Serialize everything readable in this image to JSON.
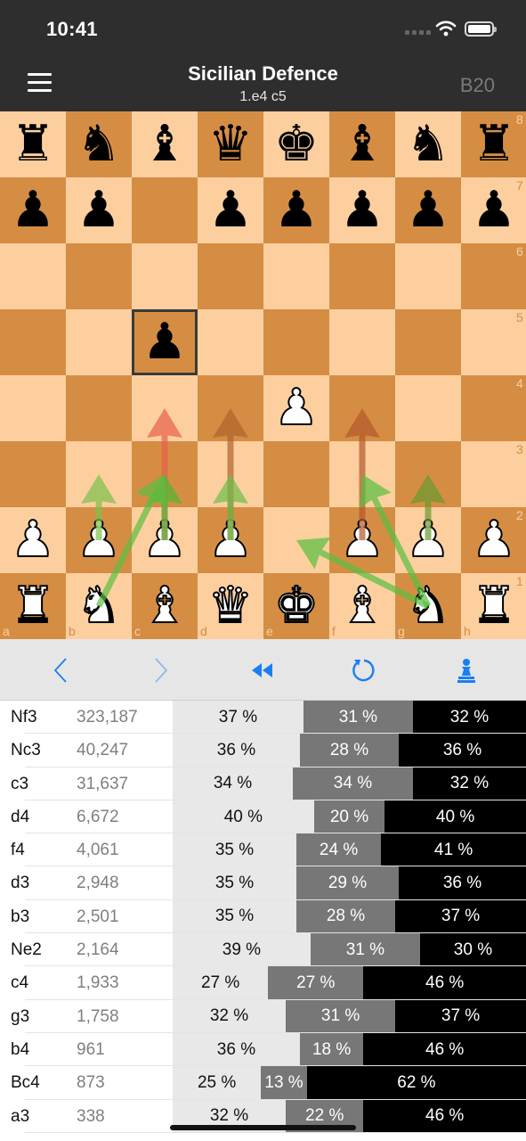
{
  "status": {
    "time": "10:41"
  },
  "nav": {
    "title": "Sicilian Defence",
    "subtitle": "1.e4 c5",
    "eco": "B20"
  },
  "board": {
    "files": [
      "a",
      "b",
      "c",
      "d",
      "e",
      "f",
      "g",
      "h"
    ],
    "ranks": [
      "8",
      "7",
      "6",
      "5",
      "4",
      "3",
      "2",
      "1"
    ],
    "last_move_square": "c5",
    "pieces": [
      {
        "sq": "a8",
        "p": "r"
      },
      {
        "sq": "b8",
        "p": "n"
      },
      {
        "sq": "c8",
        "p": "b"
      },
      {
        "sq": "d8",
        "p": "q"
      },
      {
        "sq": "e8",
        "p": "k"
      },
      {
        "sq": "f8",
        "p": "b"
      },
      {
        "sq": "g8",
        "p": "n"
      },
      {
        "sq": "h8",
        "p": "r"
      },
      {
        "sq": "a7",
        "p": "p"
      },
      {
        "sq": "b7",
        "p": "p"
      },
      {
        "sq": "d7",
        "p": "p"
      },
      {
        "sq": "e7",
        "p": "p"
      },
      {
        "sq": "f7",
        "p": "p"
      },
      {
        "sq": "g7",
        "p": "p"
      },
      {
        "sq": "h7",
        "p": "p"
      },
      {
        "sq": "c5",
        "p": "p"
      },
      {
        "sq": "e4",
        "p": "P"
      },
      {
        "sq": "a2",
        "p": "P"
      },
      {
        "sq": "b2",
        "p": "P"
      },
      {
        "sq": "c2",
        "p": "P"
      },
      {
        "sq": "d2",
        "p": "P"
      },
      {
        "sq": "f2",
        "p": "P"
      },
      {
        "sq": "g2",
        "p": "P"
      },
      {
        "sq": "h2",
        "p": "P"
      },
      {
        "sq": "a1",
        "p": "R"
      },
      {
        "sq": "b1",
        "p": "N"
      },
      {
        "sq": "c1",
        "p": "B"
      },
      {
        "sq": "d1",
        "p": "Q"
      },
      {
        "sq": "e1",
        "p": "K"
      },
      {
        "sq": "f1",
        "p": "B"
      },
      {
        "sq": "g1",
        "p": "N"
      },
      {
        "sq": "h1",
        "p": "R"
      }
    ],
    "arrows": [
      {
        "from": "c2",
        "to": "c4",
        "color": "#e8604a"
      },
      {
        "from": "d2",
        "to": "d4",
        "color": "#b0642c"
      },
      {
        "from": "f2",
        "to": "f4",
        "color": "#b4582c"
      },
      {
        "from": "b2",
        "to": "b3",
        "color": "#7cc24a"
      },
      {
        "from": "d2",
        "to": "d3",
        "color": "#6cc04a"
      },
      {
        "from": "g2",
        "to": "g3",
        "color": "#6a9a30"
      },
      {
        "from": "c2",
        "to": "c3",
        "color": "#4fb83a"
      },
      {
        "from": "b1",
        "to": "c3",
        "color": "#5cc040"
      },
      {
        "from": "g1",
        "to": "f3",
        "color": "#58c040"
      },
      {
        "from": "g1",
        "to": "e2",
        "color": "#58c040"
      }
    ],
    "colors": {
      "light": "#fdcf9f",
      "dark": "#d58d44"
    }
  },
  "toolbar": {
    "buttons": [
      {
        "name": "back-button",
        "icon": "chevron-left-icon"
      },
      {
        "name": "forward-button",
        "icon": "chevron-right-icon"
      },
      {
        "name": "rewind-button",
        "icon": "rewind-icon"
      },
      {
        "name": "flip-button",
        "icon": "rotate-icon"
      },
      {
        "name": "side-button",
        "icon": "pawn-icon"
      }
    ],
    "accent": "#1a7ef5"
  },
  "moves": [
    {
      "move": "Nf3",
      "games": "323,187",
      "white": 37,
      "draw": 31,
      "black": 32
    },
    {
      "move": "Nc3",
      "games": "40,247",
      "white": 36,
      "draw": 28,
      "black": 36
    },
    {
      "move": "c3",
      "games": "31,637",
      "white": 34,
      "draw": 34,
      "black": 32
    },
    {
      "move": "d4",
      "games": "6,672",
      "white": 40,
      "draw": 20,
      "black": 40
    },
    {
      "move": "f4",
      "games": "4,061",
      "white": 35,
      "draw": 24,
      "black": 41
    },
    {
      "move": "d3",
      "games": "2,948",
      "white": 35,
      "draw": 29,
      "black": 36
    },
    {
      "move": "b3",
      "games": "2,501",
      "white": 35,
      "draw": 28,
      "black": 37
    },
    {
      "move": "Ne2",
      "games": "2,164",
      "white": 39,
      "draw": 31,
      "black": 30
    },
    {
      "move": "c4",
      "games": "1,933",
      "white": 27,
      "draw": 27,
      "black": 46
    },
    {
      "move": "g3",
      "games": "1,758",
      "white": 32,
      "draw": 31,
      "black": 37
    },
    {
      "move": "b4",
      "games": "961",
      "white": 36,
      "draw": 18,
      "black": 46
    },
    {
      "move": "Bc4",
      "games": "873",
      "white": 25,
      "draw": 13,
      "black": 62
    },
    {
      "move": "a3",
      "games": "338",
      "white": 32,
      "draw": 22,
      "black": 46
    }
  ],
  "pct_suffix": " %"
}
